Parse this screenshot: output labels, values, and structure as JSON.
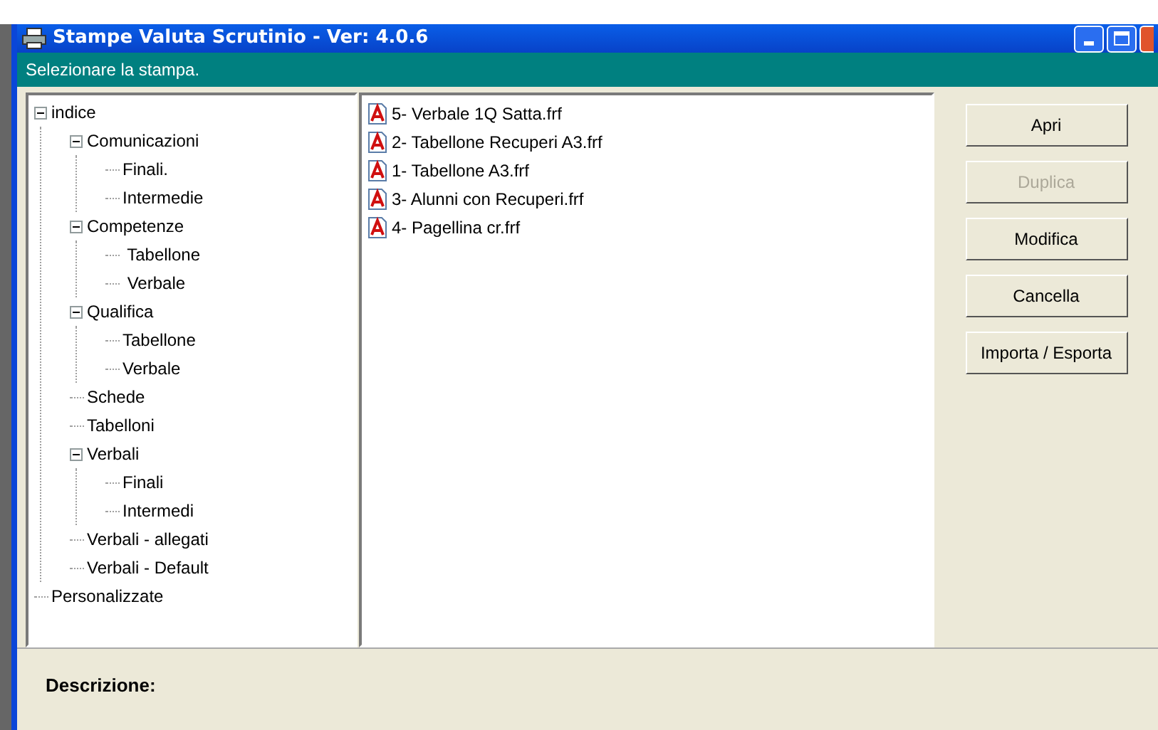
{
  "window": {
    "title": "Stampe Valuta Scrutinio - Ver: 4.0.6"
  },
  "instruction": "Selezionare la stampa.",
  "tree": [
    {
      "label": "indice",
      "expanded": true,
      "children": [
        {
          "label": "Comunicazioni",
          "expanded": true,
          "children": [
            {
              "label": "Finali."
            },
            {
              "label": "Intermedie"
            }
          ]
        },
        {
          "label": "Competenze",
          "expanded": true,
          "children": [
            {
              "label": " Tabellone"
            },
            {
              "label": " Verbale"
            }
          ]
        },
        {
          "label": "Qualifica",
          "expanded": true,
          "children": [
            {
              "label": "Tabellone"
            },
            {
              "label": "Verbale"
            }
          ]
        },
        {
          "label": "Schede"
        },
        {
          "label": "Tabelloni"
        },
        {
          "label": "Verbali",
          "expanded": true,
          "children": [
            {
              "label": "Finali"
            },
            {
              "label": "Intermedi"
            }
          ]
        },
        {
          "label": "Verbali - allegati"
        },
        {
          "label": "Verbali - Default"
        }
      ]
    },
    {
      "label": "Personalizzate"
    }
  ],
  "files": [
    "5- Verbale 1Q Satta.frf",
    "2- Tabellone Recuperi A3.frf",
    "1- Tabellone A3.frf",
    "3- Alunni con Recuperi.frf",
    "4- Pagellina cr.frf"
  ],
  "buttons": [
    {
      "label": "Apri",
      "disabled": false
    },
    {
      "label": "Duplica",
      "disabled": true
    },
    {
      "label": "Modifica",
      "disabled": false
    },
    {
      "label": "Cancella",
      "disabled": false
    },
    {
      "label": "Importa / Esporta",
      "disabled": false
    }
  ],
  "description_label": "Descrizione:"
}
